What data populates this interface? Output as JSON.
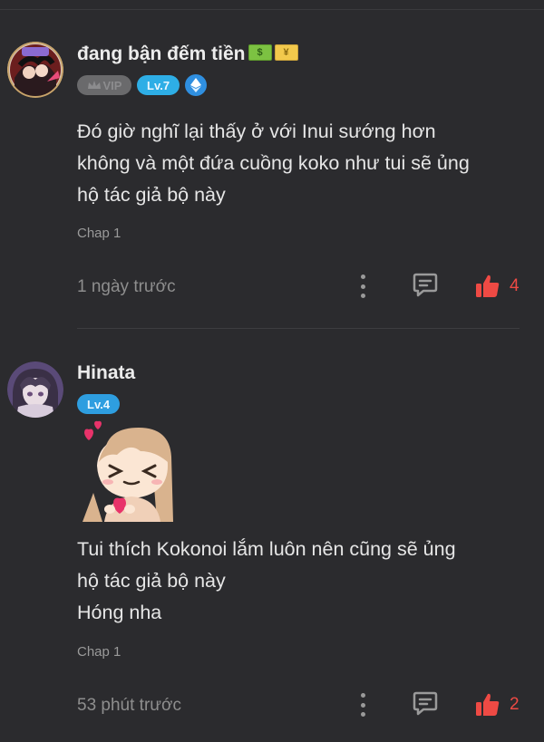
{
  "comments": [
    {
      "username": "đang bận đếm tiền",
      "emoji_1": "$",
      "emoji_2": "¥",
      "vip_label": "VIP",
      "level": "Lv.7",
      "lines": [
        "Đó giờ nghĩ lại thấy ở với Inui sướng hơn",
        "không và một đứa cuồng koko như tui sẽ ủng",
        "hộ tác giả bộ này"
      ],
      "chapter": "Chap 1",
      "time": "1 ngày trước",
      "likes": "4"
    },
    {
      "username": "Hinata",
      "level": "Lv.4",
      "lines": [
        "Tui thích Kokonoi lắm luôn nên cũng sẽ ủng",
        "hộ tác giả bộ này",
        "Hóng nha"
      ],
      "chapter": "Chap 1",
      "time": "53 phút trước",
      "likes": "2"
    }
  ],
  "colors": {
    "background": "#2b2b2e",
    "level_badge": "#2eaee6",
    "like": "#ee4a44"
  },
  "icons": [
    "more-vertical-icon",
    "reply-icon",
    "thumbs-up-icon",
    "crown-icon",
    "ethereum-icon"
  ]
}
